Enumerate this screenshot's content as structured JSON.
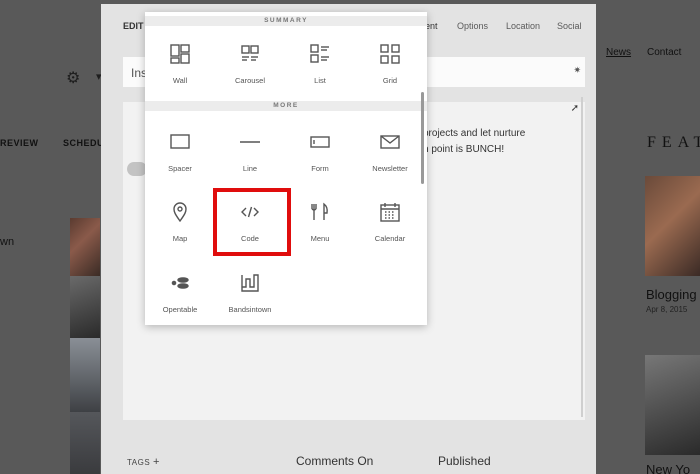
{
  "background": {
    "nav_review": "REVIEW",
    "nav_schedule": "SCHEDUL",
    "left_text": "wn",
    "right_nav": [
      "News",
      "Contact"
    ],
    "featured_heading": "FEAT",
    "blog_title": "Blogging",
    "blog_date": "Apr 8, 2015",
    "second_title": "New Yo"
  },
  "editor": {
    "tab_edit": "EDIT",
    "tabs": [
      "ent",
      "Options",
      "Location",
      "Social"
    ],
    "title_prefix": "Ins",
    "body_line1": "projects and let nurture",
    "body_line2": "n point is BUNCH!",
    "tags_label": "TAGS",
    "tags_add": "+",
    "comments_label": "Comments On",
    "published_label": "Published"
  },
  "picker": {
    "summary_header": "SUMMARY",
    "more_header": "MORE",
    "summary_blocks": [
      {
        "label": "Wall",
        "icon": "wall-icon"
      },
      {
        "label": "Carousel",
        "icon": "carousel-icon"
      },
      {
        "label": "List",
        "icon": "list-icon"
      },
      {
        "label": "Grid",
        "icon": "grid-icon"
      }
    ],
    "more_blocks": [
      {
        "label": "Spacer",
        "icon": "spacer-icon"
      },
      {
        "label": "Line",
        "icon": "line-icon"
      },
      {
        "label": "Form",
        "icon": "form-icon"
      },
      {
        "label": "Newsletter",
        "icon": "newsletter-icon"
      },
      {
        "label": "Map",
        "icon": "map-pin-icon"
      },
      {
        "label": "Code",
        "icon": "code-icon"
      },
      {
        "label": "Menu",
        "icon": "menu-icon"
      },
      {
        "label": "Calendar",
        "icon": "calendar-icon"
      },
      {
        "label": "Opentable",
        "icon": "opentable-icon"
      },
      {
        "label": "Bandsintown",
        "icon": "bandsintown-icon"
      }
    ],
    "highlighted_block": "Code",
    "highlight_color": "#e00d0d"
  }
}
